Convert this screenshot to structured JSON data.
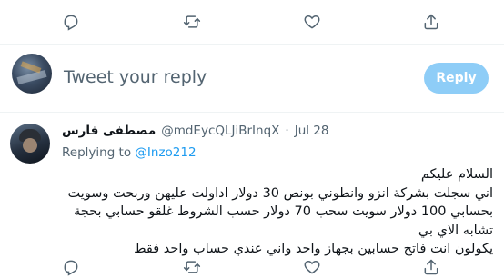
{
  "reply_box": {
    "placeholder": "Tweet your reply",
    "button_label": "Reply"
  },
  "tweet": {
    "display_name": "مصطفى فارس",
    "handle": "@mdEycQLJiBrInqX",
    "separator": "·",
    "date": "Jul 28",
    "replying_prefix": "Replying to ",
    "replying_to": "@Inzo212",
    "lines": [
      "السلام عليكم",
      "اني سجلت بشركة انزو وانطوني بونص 30 دولار اداولت عليهن وربحت وسويت",
      "بحسابي 100 دولار سويت سحب 70 دولار حسب الشروط غلقو حسابي بحجة",
      "تشابه الاي بي",
      "يكولون انت فاتح حسابين بجهاز واحد واني عندي حساب واحد فقط"
    ]
  },
  "colors": {
    "accent": "#1d9bf0",
    "reply_button_disabled": "#8ecdf7",
    "muted_text": "#536471",
    "divider": "#eff3f4"
  },
  "icons": [
    "reply-icon",
    "retweet-icon",
    "like-icon",
    "share-icon"
  ]
}
